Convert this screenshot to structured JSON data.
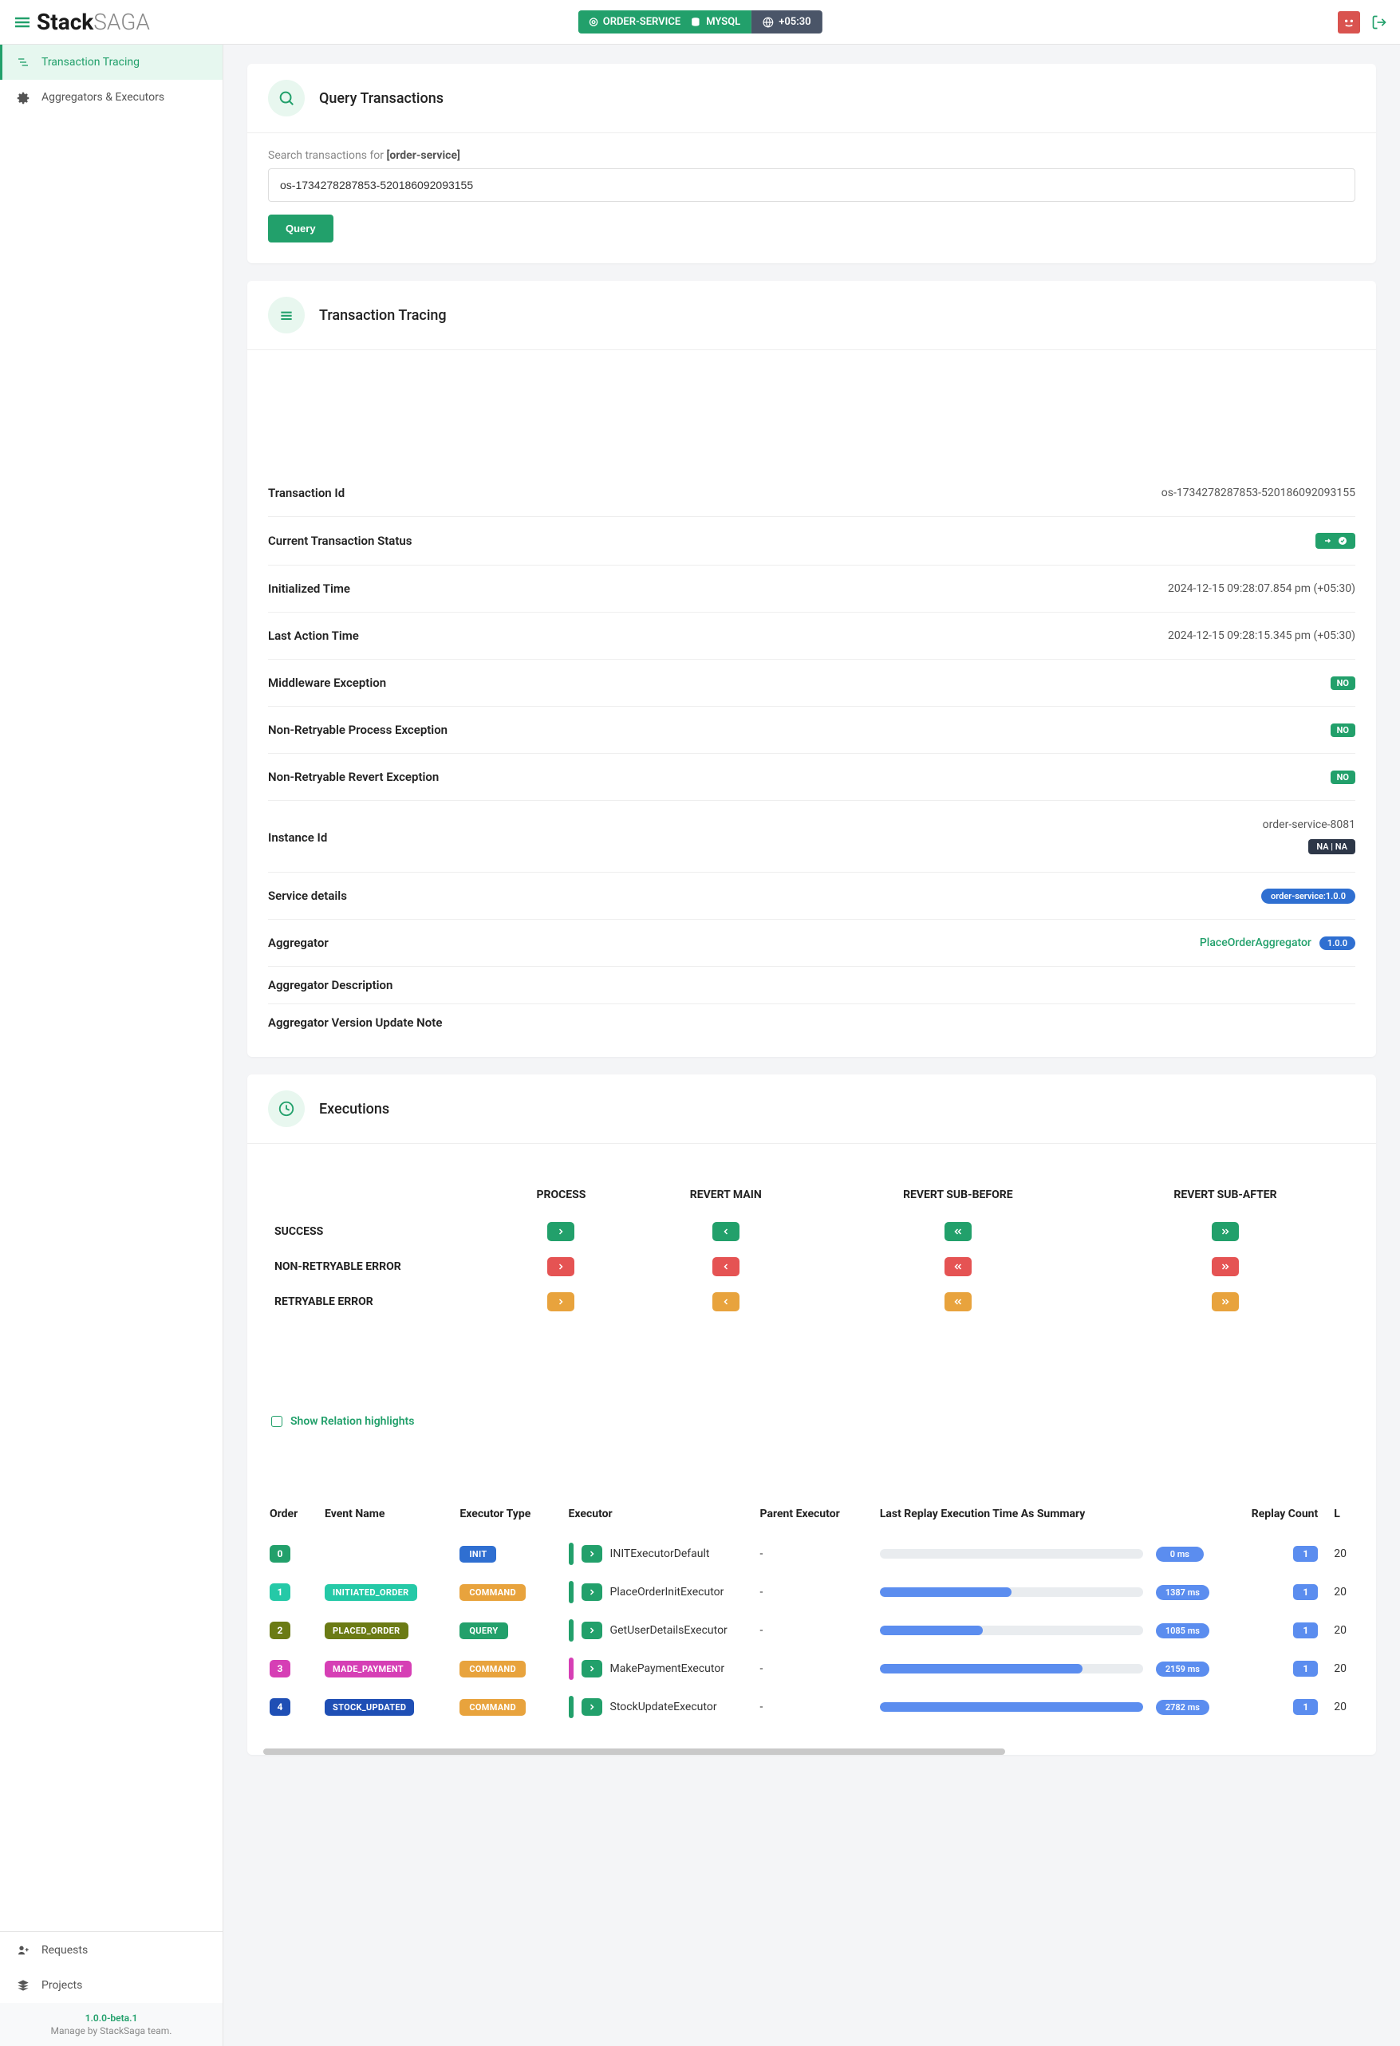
{
  "brand": {
    "name_bold": "Stack",
    "name_light": "SAGA"
  },
  "topbar": {
    "service": "ORDER-SERVICE",
    "db": "MYSQL",
    "tz": "+05:30"
  },
  "sidebar": {
    "items": [
      {
        "label": "Transaction Tracing",
        "active": true
      },
      {
        "label": "Aggregators & Executors",
        "active": false
      }
    ],
    "bottom": [
      {
        "label": "Requests"
      },
      {
        "label": "Projects"
      }
    ],
    "version": "1.0.0-beta.1",
    "managed": "Manage by StackSaga team."
  },
  "query": {
    "title": "Query Transactions",
    "label_pre": "Search transactions for ",
    "label_bold": "[order-service]",
    "value": "os-1734278287853-520186092093155",
    "button": "Query"
  },
  "tracing": {
    "title": "Transaction Tracing",
    "rows": {
      "tx_id_label": "Transaction Id",
      "tx_id": "os-1734278287853-520186092093155",
      "status_label": "Current Transaction Status",
      "init_label": "Initialized Time",
      "init_time": "2024-12-15 09:28:07.854 pm (+05:30)",
      "last_label": "Last Action Time",
      "last_time": "2024-12-15 09:28:15.345 pm (+05:30)",
      "middleware_label": "Middleware Exception",
      "middleware_val": "NO",
      "nrpe_label": "Non-Retryable Process Exception",
      "nrpe_val": "NO",
      "nrre_label": "Non-Retryable Revert Exception",
      "nrre_val": "NO",
      "instance_label": "Instance Id",
      "instance_val": "order-service-8081",
      "instance_na": "NA | NA",
      "service_label": "Service details",
      "service_val": "order-service:1.0.0",
      "agg_label": "Aggregator",
      "agg_name": "PlaceOrderAggregator",
      "agg_ver": "1.0.0",
      "agg_desc_label": "Aggregator Description",
      "agg_note_label": "Aggregator Version Update Note"
    }
  },
  "executions": {
    "title": "Executions",
    "cols": [
      "PROCESS",
      "REVERT MAIN",
      "REVERT SUB-BEFORE",
      "REVERT SUB-AFTER"
    ],
    "rows": [
      "SUCCESS",
      "NON-RETRYABLE ERROR",
      "RETRYABLE ERROR"
    ],
    "relation_label": "Show Relation highlights",
    "table": {
      "headers": [
        "Order",
        "Event Name",
        "Executor Type",
        "Executor",
        "Parent Executor",
        "Last Replay Execution Time As Summary",
        "Replay Count",
        "L"
      ],
      "rows": [
        {
          "order": "0",
          "order_bg": "#22a06b",
          "event": "",
          "event_bg": "",
          "type": "INIT",
          "type_bg": "#2f6fd1",
          "vbar": "#22a06b",
          "executor": "INITExecutorDefault",
          "parent": "-",
          "ms": "0 ms",
          "fill": 0,
          "rc": "1",
          "last": "20"
        },
        {
          "order": "1",
          "order_bg": "#25c9a7",
          "event": "INITIATED_ORDER",
          "event_bg": "#25c9a7",
          "type": "COMMAND",
          "type_bg": "#e8a33d",
          "vbar": "#22a06b",
          "executor": "PlaceOrderInitExecutor",
          "parent": "-",
          "ms": "1387 ms",
          "fill": 50,
          "rc": "1",
          "last": "20"
        },
        {
          "order": "2",
          "order_bg": "#6b7b15",
          "event": "PLACED_ORDER",
          "event_bg": "#6b7b15",
          "type": "QUERY",
          "type_bg": "#22a06b",
          "vbar": "#22a06b",
          "executor": "GetUserDetailsExecutor",
          "parent": "-",
          "ms": "1085 ms",
          "fill": 39,
          "rc": "1",
          "last": "20"
        },
        {
          "order": "3",
          "order_bg": "#d63fb5",
          "event": "MADE_PAYMENT",
          "event_bg": "#d63fb5",
          "type": "COMMAND",
          "type_bg": "#e8a33d",
          "vbar": "#d63fb5",
          "executor": "MakePaymentExecutor",
          "parent": "-",
          "ms": "2159 ms",
          "fill": 77,
          "rc": "1",
          "last": "20"
        },
        {
          "order": "4",
          "order_bg": "#1f4fb5",
          "event": "STOCK_UPDATED",
          "event_bg": "#1f4fb5",
          "type": "COMMAND",
          "type_bg": "#e8a33d",
          "vbar": "#22a06b",
          "executor": "StockUpdateExecutor",
          "parent": "-",
          "ms": "2782 ms",
          "fill": 100,
          "rc": "1",
          "last": "20"
        }
      ]
    }
  }
}
